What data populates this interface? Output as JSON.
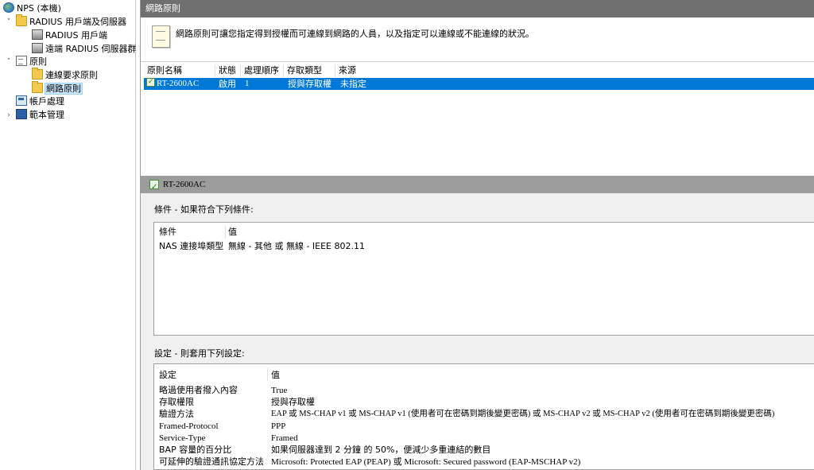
{
  "tree": {
    "root": "NPS (本機)",
    "radius_group": "RADIUS 用戶端及伺服器",
    "radius_clients": "RADIUS 用戶端",
    "remote_groups": "遠端 RADIUS 伺服器群",
    "policies": "原則",
    "conn_request": "連線要求原則",
    "network_policies": "網路原則",
    "accounting": "帳戶處理",
    "templates": "範本管理"
  },
  "header": {
    "title": "網路原則",
    "description": "網路原則可讓您指定得到授權而可連線到網路的人員，以及指定可以連線或不能連線的狀況。"
  },
  "grid": {
    "columns": [
      "原則名稱",
      "狀態",
      "處理順序",
      "存取類型",
      "來源"
    ],
    "rows": [
      {
        "name": "RT-2600AC",
        "status": "啟用",
        "order": "1",
        "access": "授與存取權",
        "source": "未指定"
      }
    ]
  },
  "detail": {
    "title": "RT-2600AC",
    "conditions_label": "條件 - 如果符合下列條件:",
    "cond_header": {
      "k": "條件",
      "v": "值"
    },
    "conditions": [
      {
        "k": "NAS 連接埠類型",
        "v": "無線 - 其他 或 無線 - IEEE 802.11"
      }
    ],
    "settings_label": "設定 - 則套用下列設定:",
    "set_header": {
      "k": "設定",
      "v": "值"
    },
    "settings": [
      {
        "k": "略過使用者撥入內容",
        "v": "True"
      },
      {
        "k": "存取權限",
        "v": "授與存取權"
      },
      {
        "k": "驗證方法",
        "v": "EAP 或 MS-CHAP v1 或 MS-CHAP v1 (使用者可在密碼到期後變更密碼) 或 MS-CHAP v2 或 MS-CHAP v2 (使用者可在密碼到期後變更密碼)"
      },
      {
        "k": "Framed-Protocol",
        "v": "PPP"
      },
      {
        "k": "Service-Type",
        "v": "Framed"
      },
      {
        "k": "BAP 容量的百分比",
        "v": "如果伺服器達到 2 分鐘 的 50%，便減少多重連結的數目"
      },
      {
        "k": "可延伸的驗證通訊協定方法",
        "v": "Microsoft: Protected EAP (PEAP) 或 Microsoft: Secured password (EAP-MSCHAP v2)"
      }
    ]
  }
}
